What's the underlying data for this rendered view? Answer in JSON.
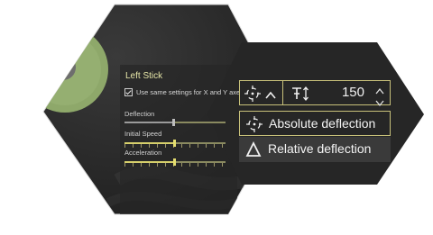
{
  "left_panel": {
    "title": "Left Stick",
    "checkbox_label": "Use same settings for X and Y axe",
    "checkbox_checked": true,
    "sliders": [
      {
        "label": "Deflection",
        "value": 0.38
      },
      {
        "label": "Initial Speed",
        "value": 0.48
      },
      {
        "label": "Acceleration",
        "value": 0.48
      }
    ]
  },
  "right_panel": {
    "value": "150",
    "options": [
      {
        "label": "Absolute deflection",
        "icon": "crosshair-icon"
      },
      {
        "label": "Relative deflection",
        "icon": "triangle-icon"
      }
    ]
  },
  "colors": {
    "panel_dark": "#262626",
    "accent_gold": "#c8c17a",
    "ring_green": "#8ea86a",
    "stick_grey": "#6e6e6e"
  }
}
